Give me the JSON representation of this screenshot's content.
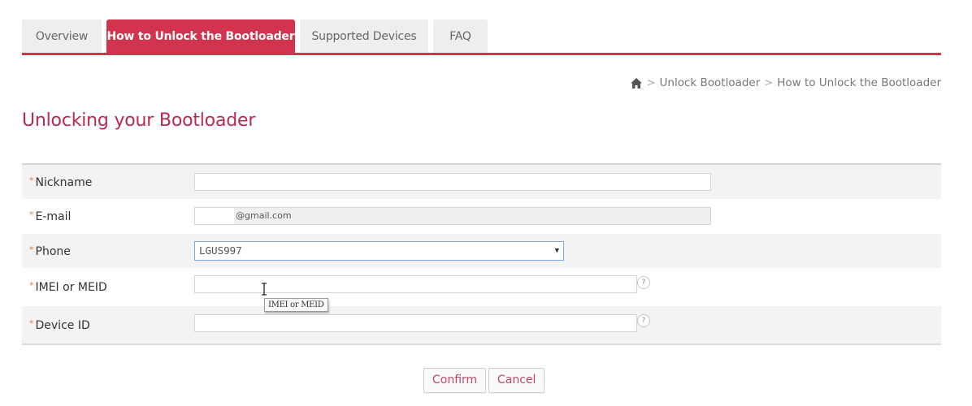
{
  "tabs": [
    {
      "label": "Overview",
      "active": false
    },
    {
      "label": "How to Unlock the Bootloader",
      "active": true
    },
    {
      "label": "Supported Devices",
      "active": false
    },
    {
      "label": "FAQ",
      "active": false
    }
  ],
  "breadcrumb": {
    "home_icon": "home-icon",
    "items": [
      "Unlock Bootloader",
      "How to Unlock the Bootloader"
    ],
    "separator": ">"
  },
  "page_title": "Unlocking your Bootloader",
  "form": {
    "required_marker": "*",
    "fields": {
      "nickname": {
        "label": "Nickname",
        "value": ""
      },
      "email": {
        "label": "E-mail",
        "value": "@gmail.com",
        "disabled": true
      },
      "phone": {
        "label": "Phone",
        "selected": "LGUS997"
      },
      "imei": {
        "label": "IMEI or MEID",
        "value": "",
        "help_icon": "?"
      },
      "device_id": {
        "label": "Device ID",
        "value": "",
        "help_icon": "?"
      }
    },
    "tooltip": "IMEI or MEID"
  },
  "buttons": {
    "confirm": "Confirm",
    "cancel": "Cancel"
  },
  "colors": {
    "accent": "#d2334d",
    "title": "#b82a52",
    "required": "#e87a4a",
    "button_text": "#c0485f"
  }
}
